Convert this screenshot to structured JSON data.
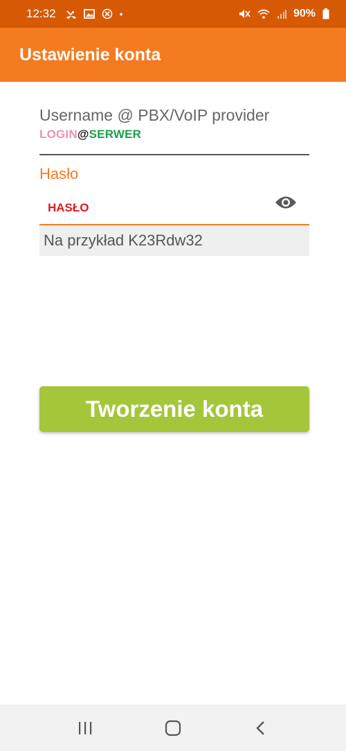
{
  "status_bar": {
    "time": "12:32",
    "battery": "90%",
    "dot": "•",
    "icons": [
      "missed-call-icon",
      "image-icon",
      "blocked-icon",
      "mute-icon",
      "wifi-icon",
      "signal-icon",
      "battery-icon"
    ]
  },
  "app_bar": {
    "title": "Ustawienie konta",
    "color": "#f47b20"
  },
  "form": {
    "username": {
      "label": "Username @ PBX/VoIP provider",
      "value_login": "LOGIN",
      "value_at": "@",
      "value_server": "SERWER"
    },
    "password": {
      "label": "Hasło",
      "value": "HASŁO",
      "toggle_icon": "eye-icon"
    },
    "hint": "Na przykład K23Rdw32"
  },
  "create_button": {
    "label": "Tworzenie konta",
    "color": "#a4c63b"
  },
  "nav_bar": {
    "icons": [
      "recent-apps-icon",
      "home-icon",
      "back-icon"
    ]
  }
}
